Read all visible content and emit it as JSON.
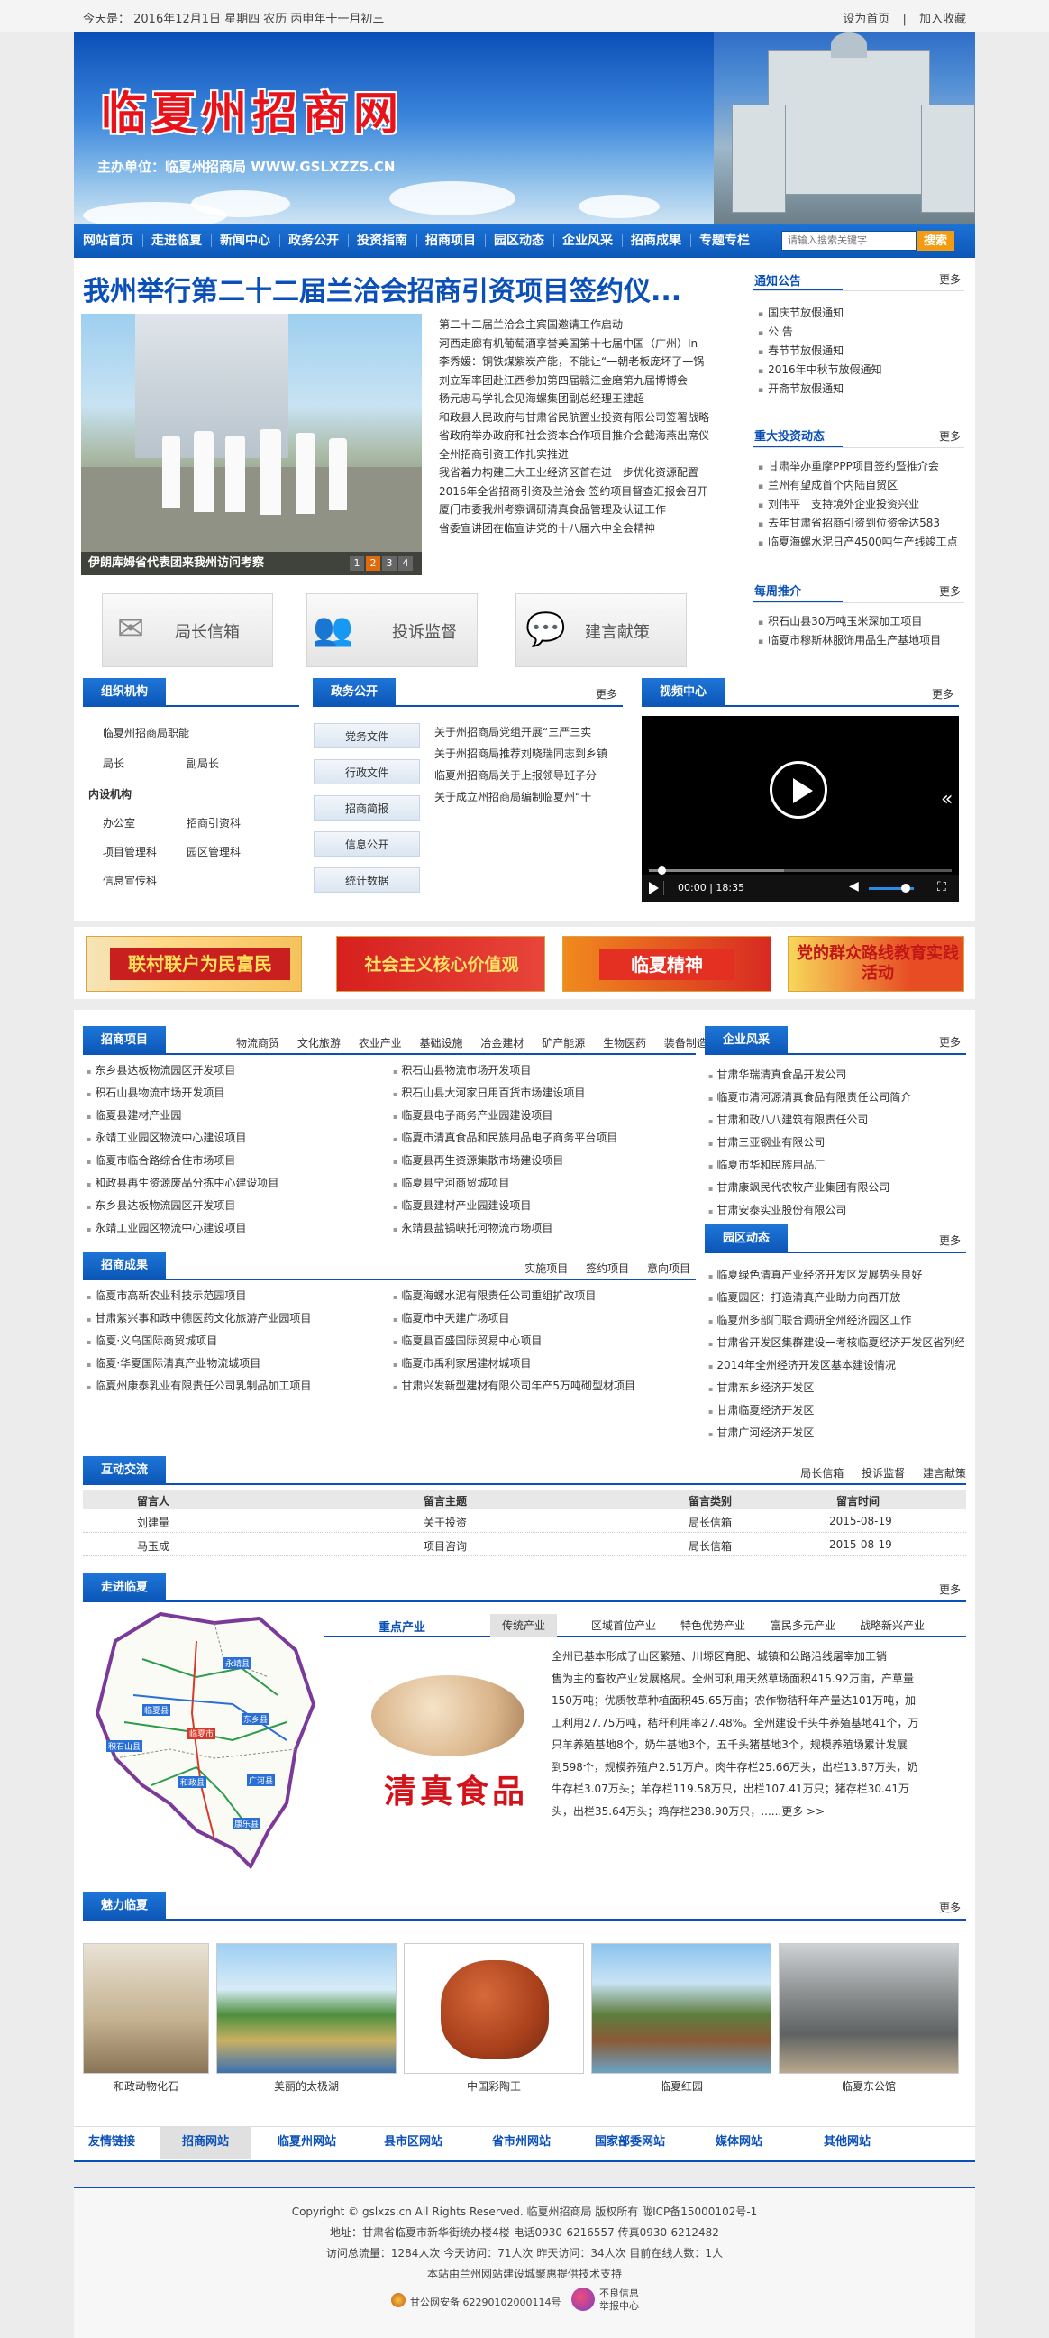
{
  "topbar": {
    "date": "今天是： 2016年12月1日 星期四 农历 丙申年十一月初三",
    "set_home": "设为首页",
    "sep": "|",
    "add_fav": "加入收藏"
  },
  "banner": {
    "title": "临夏州招商网",
    "subtitle": "主办单位：临夏州招商局   WWW.GSLXZZS.CN"
  },
  "nav": {
    "items": [
      "网站首页",
      "走进临夏",
      "新闻中心",
      "政务公开",
      "投资指南",
      "招商项目",
      "园区动态",
      "企业风采",
      "招商成果",
      "专题专栏"
    ],
    "search_placeholder": "请输入搜索关键字",
    "search_button": "搜索"
  },
  "headline": {
    "title": "我州举行第二十二届兰洽会招商引资项目签约仪...",
    "photo_caption": "伊朗库姆省代表团来我州访问考察",
    "pages": [
      "1",
      "2",
      "3",
      "4"
    ],
    "lead_lines": [
      "第二十二届兰洽会主宾国邀请工作启动",
      "河西走廊有机葡萄酒享誉美国第十七届中国（广州）In",
      "李秀媛：铜铁煤紫炭产能，不能让“一朝老板庞坏了一锅",
      "刘立军率团赴江西参加第四届赣江金磨第九届博博会",
      "杨元忠马学礼会见海螺集团副总经理王建超",
      "和政县人民政府与甘肃省民航置业投资有限公司签署战略",
      "省政府举办政府和社会资本合作项目推介会截海燕出席仪",
      "全州招商引资工作扎实推进",
      "我省着力构建三大工业经济区首在进一步优化资源配置",
      "2016年全省招商引资及兰洽会 签约项目督查汇报会召开",
      "厦门市委我州考察调研清真食品管理及认证工作",
      "省委宣讲团在临宣讲党的十八届六中全会精神"
    ]
  },
  "notice": {
    "title": "通知公告",
    "more": "更多",
    "items": [
      "国庆节放假通知",
      "公 告",
      "春节节放假通知",
      "2016年中秋节放假通知",
      "开斋节放假通知"
    ]
  },
  "major": {
    "title": "重大投资动态",
    "more": "更多",
    "items": [
      "甘肃举办重摩PPP项目签约暨推介会",
      "兰州有望成首个内陆自贸区",
      "刘伟平　支持境外企业投资兴业",
      "去年甘肃省招商引资到位资金达583",
      "临夏海螺水泥日产4500吨生产线竣工点"
    ]
  },
  "weekly": {
    "title": "每周推介",
    "more": "更多",
    "items": [
      "积石山县30万吨玉米深加工项目",
      "临夏市穆斯林服饰用品生产基地项目"
    ]
  },
  "shortcuts": [
    {
      "icon": "✉",
      "label": "局长信箱"
    },
    {
      "icon": "👥",
      "label": "投诉监督"
    },
    {
      "icon": "💬",
      "label": "建言献策"
    }
  ],
  "org": {
    "title": "组织机构",
    "head": "临夏州招商局职能",
    "chief": "局长",
    "deputy": "副局长",
    "inner": "内设机构",
    "units": [
      "办公室",
      "招商引资科",
      "项目管理科",
      "园区管理科",
      "信息宣传科"
    ]
  },
  "gov": {
    "title": "政务公开",
    "more": "更多",
    "buttons": [
      "党务文件",
      "行政文件",
      "招商简报",
      "信息公开",
      "统计数据"
    ],
    "items": [
      "关于州招商局党组开展“三严三实",
      "关于州招商局推荐刘晓瑞同志到乡镇",
      "临夏州招商局关于上报领导班子分",
      "关于成立州招商局编制临夏州“十"
    ]
  },
  "video": {
    "title": "视频中心",
    "more": "更多",
    "time": "00:00 | 18:35"
  },
  "promo": [
    "联村联户为民富民",
    "社会主义核心价值观",
    "临夏精神",
    "党的群众路线教育实践活动"
  ],
  "projects": {
    "title": "招商项目",
    "subtabs": [
      "物流商贸",
      "文化旅游",
      "农业产业",
      "基础设施",
      "冶金建材",
      "矿产能源",
      "生物医药",
      "装备制造"
    ],
    "col1": [
      "东乡县达板物流园区开发项目",
      "积石山县物流市场开发项目",
      "临夏县建材产业园",
      "永靖工业园区物流中心建设项目",
      "临夏市临合路综合住市场项目",
      "和政县再生资源废品分拣中心建设项目",
      "东乡县达板物流园区开发项目",
      "永靖工业园区物流中心建设项目"
    ],
    "col2": [
      "积石山县物流市场开发项目",
      "积石山县大河家日用百货市场建设项目",
      "临夏县电子商务产业园建设项目",
      "临夏市清真食品和民族用品电子商务平台项目",
      "临夏县再生资源集散市场建设项目",
      "临夏县宁河商贸城项目",
      "临夏县建材产业园建设项目",
      "永靖县盐锅峡托河物流市场项目"
    ]
  },
  "results": {
    "title": "招商成果",
    "subtabs": [
      "实施项目",
      "签约项目",
      "意向项目"
    ],
    "col1": [
      "临夏市高新农业科技示范园项目",
      "甘肃紫兴事和政中德医药文化旅游产业园项目",
      "临夏·义乌国际商贸城项目",
      "临夏·华夏国际清真产业物流城项目",
      "临夏州康泰乳业有限责任公司乳制品加工项目"
    ],
    "col2": [
      "临夏海螺水泥有限责任公司重组扩改项目",
      "临夏市中天建广场项目",
      "临夏县百盛国际贸易中心项目",
      "临夏市禹利家居建材城项目",
      "甘肃兴发新型建材有限公司年产5万吨砌型材项目"
    ]
  },
  "enterprise": {
    "title": "企业风采",
    "more": "更多",
    "items": [
      "甘肃华瑞清真食品开发公司",
      "临夏市清河源清真食品有限责任公司简介",
      "甘肃和政八八建筑有限责任公司",
      "甘肃三亚钢业有限公司",
      "临夏市华和民族用品厂",
      "甘肃康飒民代农牧产业集团有限公司",
      "甘肃安泰实业股份有限公司"
    ]
  },
  "park": {
    "title": "园区动态",
    "more": "更多",
    "items": [
      "临夏绿色清真产业经济开发区发展势头良好",
      "临夏园区：打造清真产业助力向西开放",
      "临夏州多部门联合调研全州经济园区工作",
      "甘肃省开发区集群建设一考核临夏经济开发区省列经济开",
      "2014年全州经济开发区基本建设情况",
      "甘肃东乡经济开发区",
      "甘肃临夏经济开发区",
      "甘肃广河经济开发区"
    ]
  },
  "interact": {
    "title": "互动交流",
    "subtabs": [
      "局长信箱",
      "投诉监督",
      "建言献策"
    ],
    "headers": [
      "留言人",
      "留言主题",
      "留言类别",
      "留言时间"
    ],
    "rows": [
      [
        "刘建量",
        "关于投资",
        "局长信箱",
        "2015-08-19"
      ],
      [
        "马玉成",
        "项目咨询",
        "局长信箱",
        "2015-08-19"
      ]
    ]
  },
  "linxia": {
    "title": "走进临夏",
    "more": "更多",
    "tabs": [
      "重点产业",
      "传统产业",
      "区域首位产业",
      "特色优势产业",
      "富民多元产业",
      "战略新兴产业"
    ],
    "map_labels": [
      "永靖县",
      "东乡县",
      "临夏县",
      "临夏市",
      "和政县",
      "广河县",
      "康乐县",
      "积石山县"
    ],
    "photo_text": "清真食品",
    "body_lines": [
      "全州已基本形成了山区繁殖、川塬区育肥、城镇和公路沿线屠宰加工销",
      "售为主的畜牧产业发展格局。全州可利用天然草场面积415.92万亩，产草量",
      "150万吨；优质牧草种植面积45.65万亩；农作物秸秆年产量达101万吨，加",
      "工利用27.75万吨，秸秆利用率27.48%。全州建设千头牛养殖基地41个，万",
      "只羊养殖基地8个，奶牛基地3个，五千头猪基地3个，规模养殖场累计发展",
      "到598个，规模养殖户2.51万户。肉牛存栏25.66万头，出栏13.87万头，奶",
      "牛存栏3.07万头；羊存栏119.58万只，出栏107.41万只；猪存栏30.41万",
      "头，出栏35.64万头；鸡存栏238.90万只，"
    ],
    "more_link": "......更多 >>"
  },
  "charm": {
    "title": "魅力临夏",
    "more": "更多",
    "items": [
      "和政动物化石",
      "美丽的太极湖",
      "中国彩陶王",
      "临夏红园",
      "临夏东公馆"
    ]
  },
  "friend": {
    "tabs": [
      "友情链接",
      "招商网站",
      "临夏州网站",
      "县市区网站",
      "省市州网站",
      "国家部委网站",
      "媒体网站",
      "其他网站"
    ]
  },
  "footer": {
    "lines": [
      "Copyright © gslxzs.cn All Rights Reserved. 临夏州招商局 版权所有 陇ICP备15000102号-1",
      "地址：甘肃省临夏市新华街统办楼4楼 电话0930-6216557 传真0930-6212482",
      "访问总流量：1284人次 今天访问：71人次 昨天访问：34人次 目前在线人数：1人",
      "本站由兰州网站建设城聚惠提供技术支持"
    ],
    "badge1": "甘公网安备 62290102000114号",
    "badge2_a": "不良信息",
    "badge2_b": "举报中心"
  }
}
